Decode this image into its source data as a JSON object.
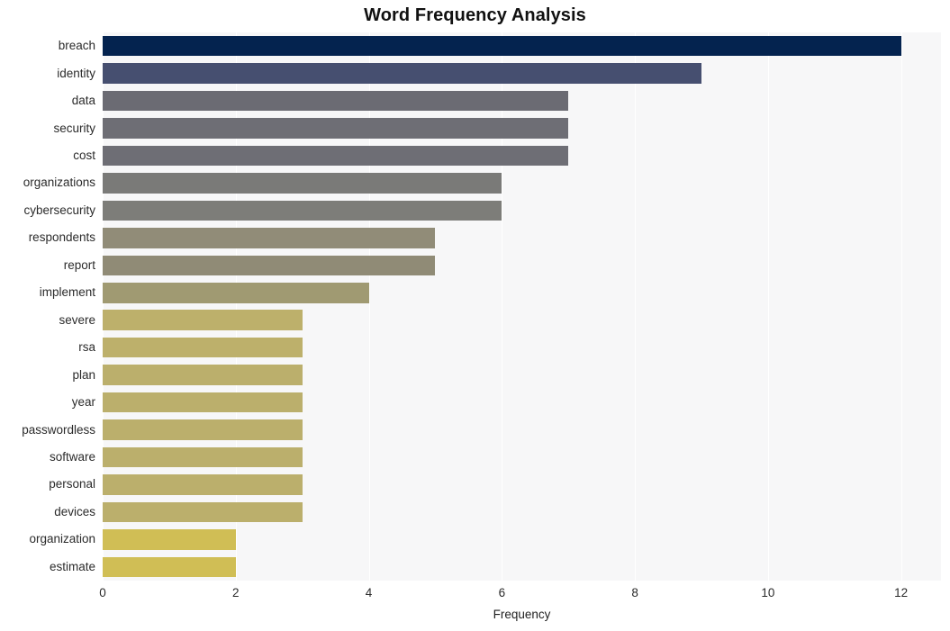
{
  "chart_data": {
    "type": "bar",
    "orientation": "horizontal",
    "title": "Word Frequency Analysis",
    "xlabel": "Frequency",
    "ylabel": "",
    "xlim": [
      0,
      12.6
    ],
    "xticks": [
      0,
      2,
      4,
      6,
      8,
      10,
      12
    ],
    "xtick_labels": [
      "0",
      "2",
      "4",
      "6",
      "8",
      "10",
      "12"
    ],
    "grid": true,
    "grid_axis": "x",
    "legend": false,
    "categories": [
      "breach",
      "identity",
      "data",
      "security",
      "cost",
      "organizations",
      "cybersecurity",
      "respondents",
      "report",
      "implement",
      "severe",
      "rsa",
      "plan",
      "year",
      "passwordless",
      "software",
      "personal",
      "devices",
      "organization",
      "estimate"
    ],
    "values": [
      12,
      9,
      7,
      7,
      7,
      6,
      6,
      5,
      5,
      4,
      3,
      3,
      3,
      3,
      3,
      3,
      3,
      3,
      2,
      2
    ],
    "bar_colors": [
      "#04234f",
      "#464f70",
      "#6b6b73",
      "#6e6e75",
      "#6e6e75",
      "#7a7a78",
      "#7d7d79",
      "#918c78",
      "#908b76",
      "#a09a72",
      "#bdb06b",
      "#bdb06b",
      "#bbaf6c",
      "#bbaf6c",
      "#bbaf6c",
      "#bbaf6c",
      "#bbaf6c",
      "#bbaf6c",
      "#d0be55",
      "#d0be55"
    ],
    "plot_background": "#f7f7f8",
    "figure_background": "#ffffff",
    "gridline_color": "#ffffff",
    "text_color": "#2b2b2b"
  }
}
